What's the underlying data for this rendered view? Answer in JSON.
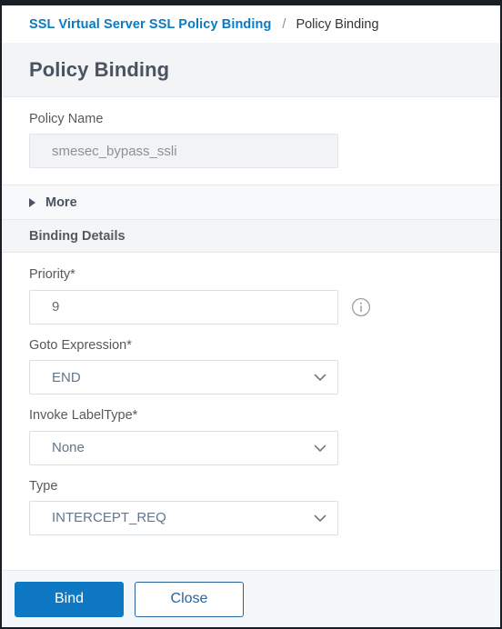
{
  "breadcrumb": {
    "parent": "SSL Virtual Server SSL Policy Binding",
    "separator": "/",
    "current": "Policy Binding"
  },
  "page": {
    "title": "Policy Binding"
  },
  "form": {
    "policy_name": {
      "label": "Policy Name",
      "value": "smesec_bypass_ssli",
      "placeholder": "Policy Name",
      "disabled": true
    },
    "more": {
      "label": "More",
      "expanded": false
    },
    "binding_details": {
      "title": "Binding Details",
      "priority": {
        "label": "Priority*",
        "value": "9",
        "placeholder": "Priority",
        "info_icon": "info-circle-icon"
      },
      "goto_expression": {
        "label": "Goto Expression*",
        "value": "END",
        "icon": "chevron-down-icon"
      },
      "invoke_label_type": {
        "label": "Invoke LabelType*",
        "value": "None",
        "icon": "chevron-down-icon"
      },
      "type": {
        "label": "Type",
        "value": "INTERCEPT_REQ",
        "icon": "chevron-down-icon"
      }
    }
  },
  "footer": {
    "bind_label": "Bind",
    "close_label": "Close"
  },
  "colors": {
    "link_blue": "#0a7ac3",
    "primary_button": "#0f78c3",
    "secondary_button_border": "#2a6496",
    "title_text": "#4a5361",
    "top_strip": "#1a1f27",
    "footer_bg": "#f5f8fa",
    "band_bg": "#f2f4f5"
  }
}
